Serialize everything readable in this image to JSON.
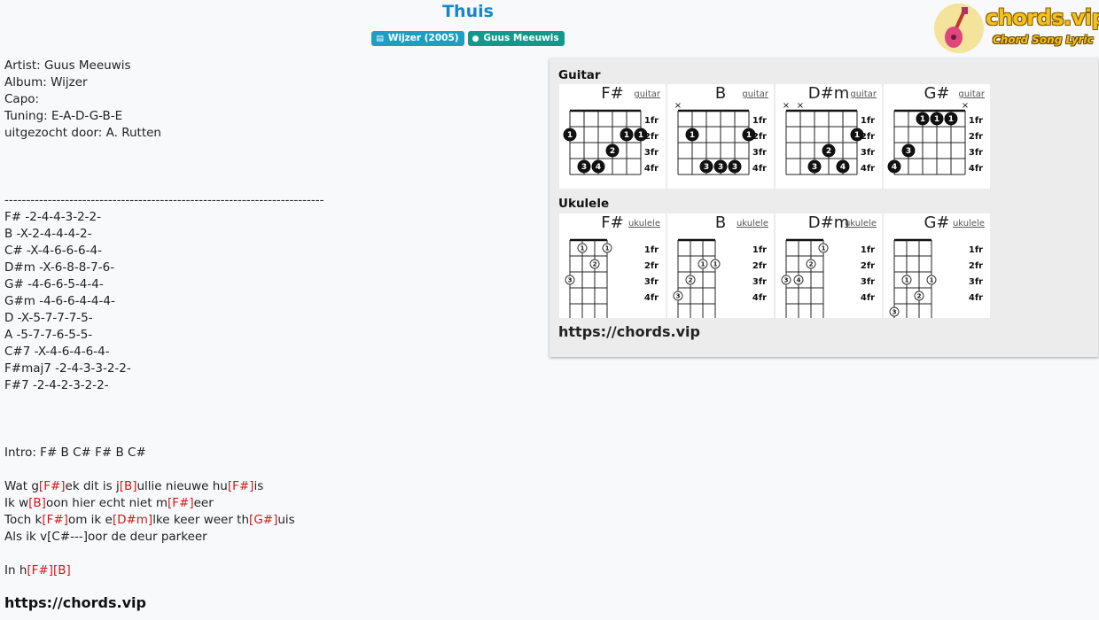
{
  "header": {
    "title": "Thuis",
    "album_badge": "Wijzer (2005)",
    "artist_badge": "Guus Meeuwis"
  },
  "logo": {
    "name": "chords.vip",
    "tagline": "Chord Song Lyric"
  },
  "meta": {
    "artist": "Artist: Guus Meeuwis",
    "album": "Album: Wijzer",
    "capo": "Capo:",
    "tuning": "Tuning: E-A-D-G-B-E",
    "author": "uitgezocht door: A. Rutten"
  },
  "sheet_lines": [
    [
      {
        "t": "Artist: Guus Meeuwis"
      }
    ],
    [
      {
        "t": "Album: Wijzer"
      }
    ],
    [
      {
        "t": "Capo:"
      }
    ],
    [
      {
        "t": "Tuning: E-A-D-G-B-E"
      }
    ],
    [
      {
        "t": "uitgezocht door: A. Rutten"
      }
    ],
    [],
    [],
    [],
    [
      {
        "t": "--------------------------------------------------------------------------"
      }
    ],
    [
      {
        "t": "F# -2-4-4-3-2-2-"
      }
    ],
    [
      {
        "t": "B -X-2-4-4-4-2-"
      }
    ],
    [
      {
        "t": "C# -X-4-6-6-6-4-"
      }
    ],
    [
      {
        "t": "D#m -X-6-8-8-7-6-"
      }
    ],
    [
      {
        "t": "G# -4-6-6-5-4-4-"
      }
    ],
    [
      {
        "t": "G#m -4-6-6-4-4-4-"
      }
    ],
    [
      {
        "t": "D -X-5-7-7-7-5-"
      }
    ],
    [
      {
        "t": "A -5-7-7-6-5-5-"
      }
    ],
    [
      {
        "t": "C#7 -X-4-6-4-6-4-"
      }
    ],
    [
      {
        "t": "F#maj7 -2-4-3-3-2-2-"
      }
    ],
    [
      {
        "t": "F#7 -2-4-2-3-2-2-"
      }
    ],
    [],
    [],
    [],
    [
      {
        "t": "Intro: F# B C# F# B C#"
      }
    ],
    [],
    [
      {
        "t": "Wat g"
      },
      {
        "c": "[F#]"
      },
      {
        "t": "ek dit is j"
      },
      {
        "c": "[B]"
      },
      {
        "t": "ullie nieuwe hu"
      },
      {
        "c": "[F#]"
      },
      {
        "t": "is"
      }
    ],
    [
      {
        "t": "Ik w"
      },
      {
        "c": "[B]"
      },
      {
        "t": "oon hier echt niet m"
      },
      {
        "c": "[F#]"
      },
      {
        "t": "eer"
      }
    ],
    [
      {
        "t": "Toch k"
      },
      {
        "c": "[F#]"
      },
      {
        "t": "om ik e"
      },
      {
        "c": "[D#m]"
      },
      {
        "t": "lke keer weer th"
      },
      {
        "c": "[G#]"
      },
      {
        "t": "uis"
      }
    ],
    [
      {
        "t": "Als ik v[C#---]oor de deur parkeer"
      }
    ],
    [],
    [
      {
        "t": "In h"
      },
      {
        "c": "[F#]"
      },
      {
        "c": "[B]"
      }
    ]
  ],
  "footer_url": "https://chords.vip",
  "panel": {
    "guitar_label": "Guitar",
    "ukulele_label": "Ukulele",
    "url": "https://chords.vip",
    "fret_labels": [
      "1fr",
      "2fr",
      "3fr",
      "4fr"
    ],
    "guitar_chords": [
      {
        "name": "F#",
        "link": "guitar",
        "muted": [],
        "barre": {
          "fret": 2,
          "from": 0,
          "to": 5
        },
        "dots": [
          {
            "s": 0,
            "f": 2,
            "n": "1"
          },
          {
            "s": 4,
            "f": 2,
            "n": "1"
          },
          {
            "s": 5,
            "f": 2,
            "n": "1"
          },
          {
            "s": 3,
            "f": 3,
            "n": "2"
          },
          {
            "s": 1,
            "f": 4,
            "n": "3"
          },
          {
            "s": 2,
            "f": 4,
            "n": "4"
          }
        ]
      },
      {
        "name": "B",
        "link": "guitar",
        "muted": [
          0
        ],
        "barre": {
          "fret": 2,
          "from": 1,
          "to": 5
        },
        "dots": [
          {
            "s": 1,
            "f": 2,
            "n": "1"
          },
          {
            "s": 5,
            "f": 2,
            "n": "1"
          },
          {
            "s": 2,
            "f": 4,
            "n": "3"
          },
          {
            "s": 3,
            "f": 4,
            "n": "3"
          },
          {
            "s": 4,
            "f": 4,
            "n": "3"
          }
        ]
      },
      {
        "name": "D#m",
        "link": "guitar",
        "muted": [
          0,
          1
        ],
        "barre": null,
        "dots": [
          {
            "s": 5,
            "f": 2,
            "n": "1"
          },
          {
            "s": 3,
            "f": 3,
            "n": "2"
          },
          {
            "s": 2,
            "f": 4,
            "n": "3"
          },
          {
            "s": 4,
            "f": 4,
            "n": "4"
          }
        ]
      },
      {
        "name": "G#",
        "link": "guitar",
        "muted": [
          5
        ],
        "barre": null,
        "dots": [
          {
            "s": 2,
            "f": 1,
            "n": "1"
          },
          {
            "s": 3,
            "f": 1,
            "n": "1"
          },
          {
            "s": 4,
            "f": 1,
            "n": "1"
          },
          {
            "s": 1,
            "f": 3,
            "n": "3"
          },
          {
            "s": 0,
            "f": 4,
            "n": "4"
          }
        ]
      }
    ],
    "ukulele_chords": [
      {
        "name": "F#",
        "link": "ukulele",
        "dots": [
          {
            "s": 1,
            "f": 1,
            "n": "1"
          },
          {
            "s": 3,
            "f": 1,
            "n": "1"
          },
          {
            "s": 2,
            "f": 2,
            "n": "2"
          },
          {
            "s": 0,
            "f": 3,
            "n": "3"
          }
        ]
      },
      {
        "name": "B",
        "link": "ukulele",
        "dots": [
          {
            "s": 2,
            "f": 2,
            "n": "1"
          },
          {
            "s": 3,
            "f": 2,
            "n": "1"
          },
          {
            "s": 1,
            "f": 3,
            "n": "2"
          },
          {
            "s": 0,
            "f": 4,
            "n": "3"
          }
        ]
      },
      {
        "name": "D#m",
        "link": "ukulele",
        "dots": [
          {
            "s": 3,
            "f": 1,
            "n": "1"
          },
          {
            "s": 2,
            "f": 2,
            "n": "2"
          },
          {
            "s": 0,
            "f": 3,
            "n": "3"
          },
          {
            "s": 1,
            "f": 3,
            "n": "4"
          }
        ]
      },
      {
        "name": "G#",
        "link": "ukulele",
        "dots": [
          {
            "s": 1,
            "f": 3,
            "n": "1"
          },
          {
            "s": 3,
            "f": 3,
            "n": "1"
          },
          {
            "s": 2,
            "f": 4,
            "n": "2"
          },
          {
            "s": 0,
            "f": 5,
            "n": "3"
          }
        ]
      }
    ]
  }
}
